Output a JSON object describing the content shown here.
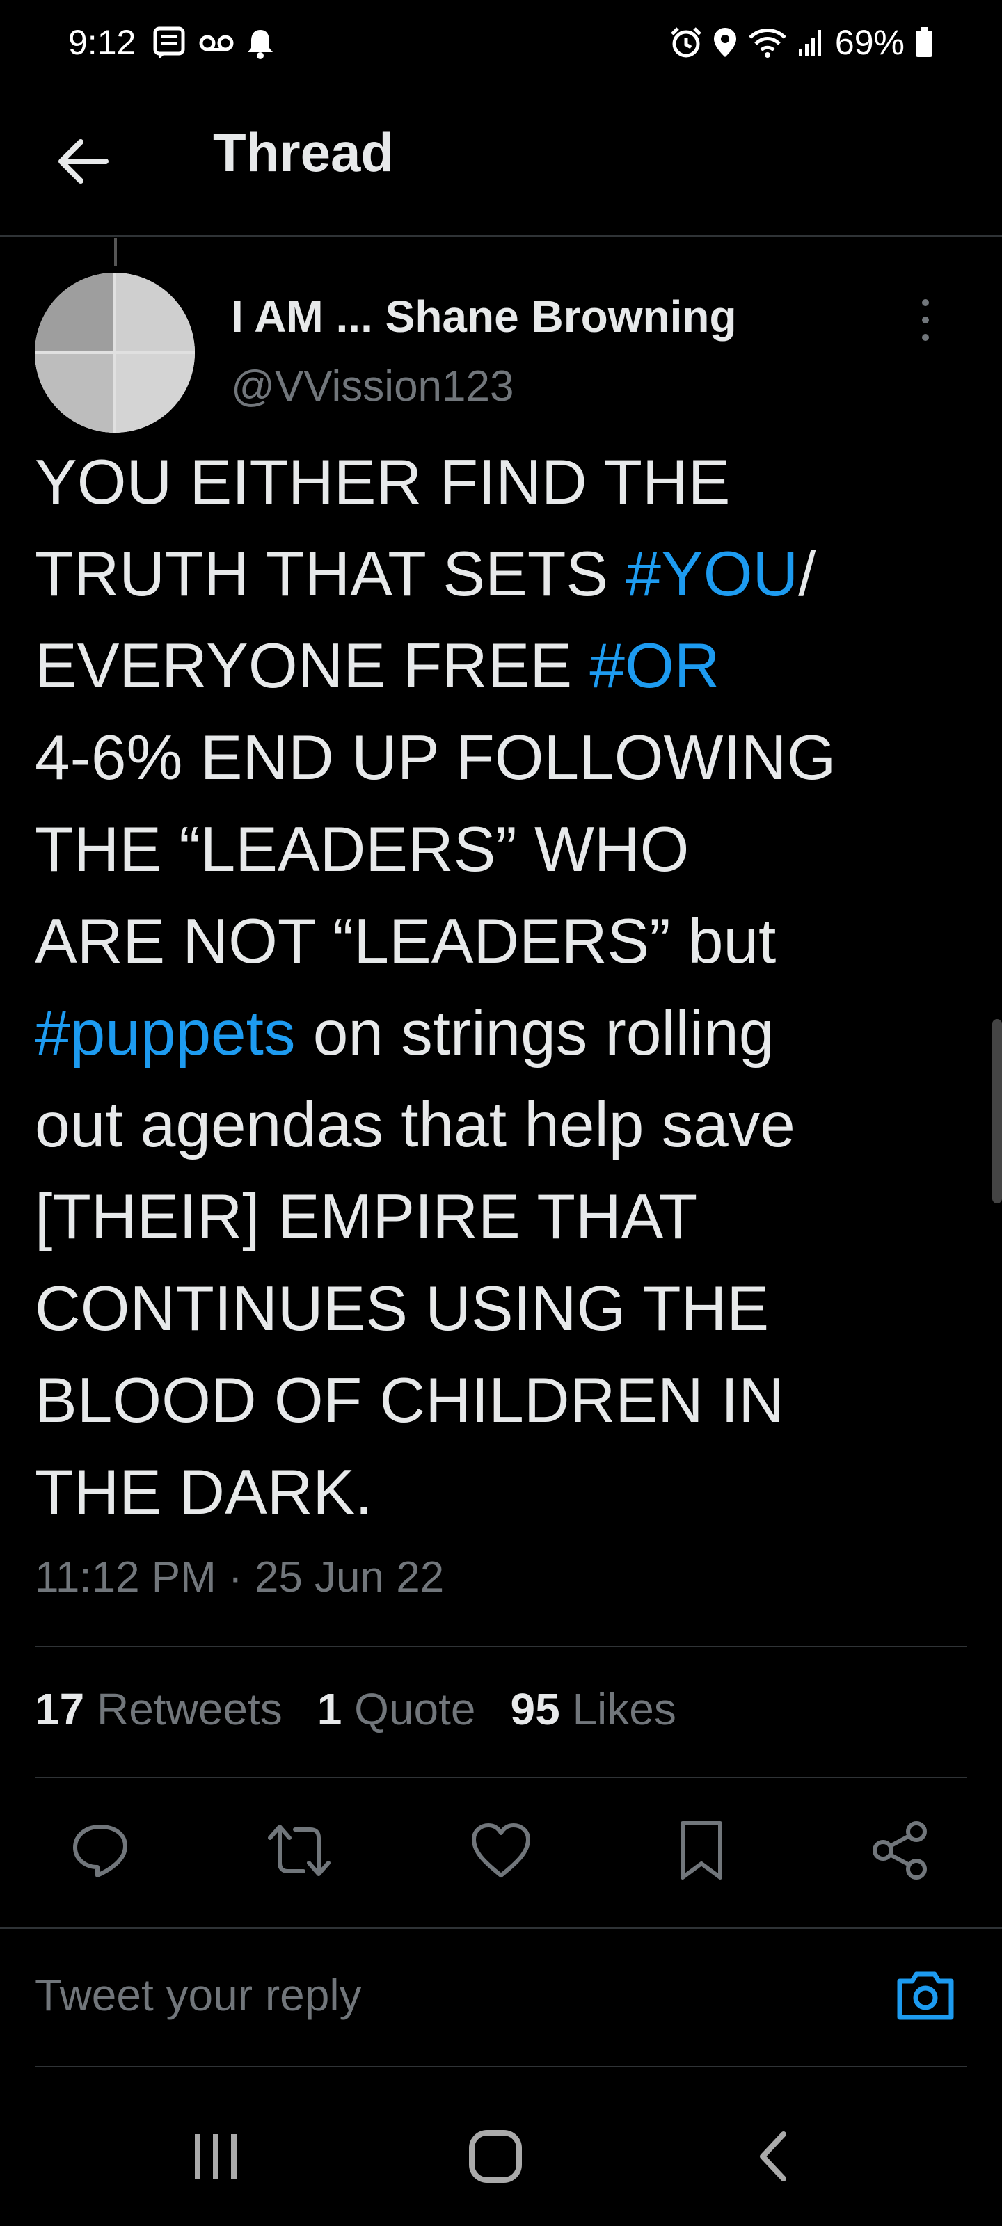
{
  "status_bar": {
    "time": "9:12",
    "battery": "69%",
    "left_icons": [
      "message-icon",
      "voicemail-icon",
      "notification-bell-icon"
    ],
    "right_icons": [
      "alarm-icon",
      "location-icon",
      "wifi-icon",
      "signal-icon",
      "battery-icon"
    ]
  },
  "header": {
    "back_icon": "arrow-left-icon",
    "title": "Thread"
  },
  "tweet": {
    "author_name": "I AM ... Shane Browning",
    "author_handle": "@VVission123",
    "lines": [
      [
        {
          "text": "YOU EITHER FIND THE"
        }
      ],
      [
        {
          "text": "TRUTH THAT SETS "
        },
        {
          "text": "#YOU",
          "hashtag": true
        },
        {
          "text": "/"
        }
      ],
      [
        {
          "text": "EVERYONE FREE "
        },
        {
          "text": "#OR",
          "hashtag": true
        }
      ],
      [
        {
          "text": "4-6% END UP FOLLOWING"
        }
      ],
      [
        {
          "text": "THE “LEADERS” WHO"
        }
      ],
      [
        {
          "text": "ARE NOT “LEADERS” but"
        }
      ],
      [
        {
          "text": "#puppets",
          "hashtag": true
        },
        {
          "text": " on strings rolling"
        }
      ],
      [
        {
          "text": "out agendas that help save"
        }
      ],
      [
        {
          "text": "[THEIR] EMPIRE THAT"
        }
      ],
      [
        {
          "text": "CONTINUES USING THE"
        }
      ],
      [
        {
          "text": "BLOOD OF CHILDREN IN"
        }
      ],
      [
        {
          "text": "THE DARK."
        }
      ]
    ],
    "timestamp": "11:12 PM · 25 Jun 22",
    "stats": {
      "retweets_count": "17",
      "retweets_label": "Retweets",
      "quotes_count": "1",
      "quotes_label": "Quote",
      "likes_count": "95",
      "likes_label": "Likes"
    },
    "actions": [
      "reply-icon",
      "retweet-icon",
      "like-icon",
      "bookmark-icon",
      "share-icon"
    ]
  },
  "reply": {
    "placeholder": "Tweet your reply",
    "camera_icon": "camera-icon"
  },
  "colors": {
    "background": "#000000",
    "text": "#e7e9ea",
    "secondary": "#71767b",
    "accent": "#1d9bf0",
    "divider": "#2f3336"
  },
  "nav_bar": [
    "recent-apps-icon",
    "home-icon",
    "back-icon"
  ]
}
